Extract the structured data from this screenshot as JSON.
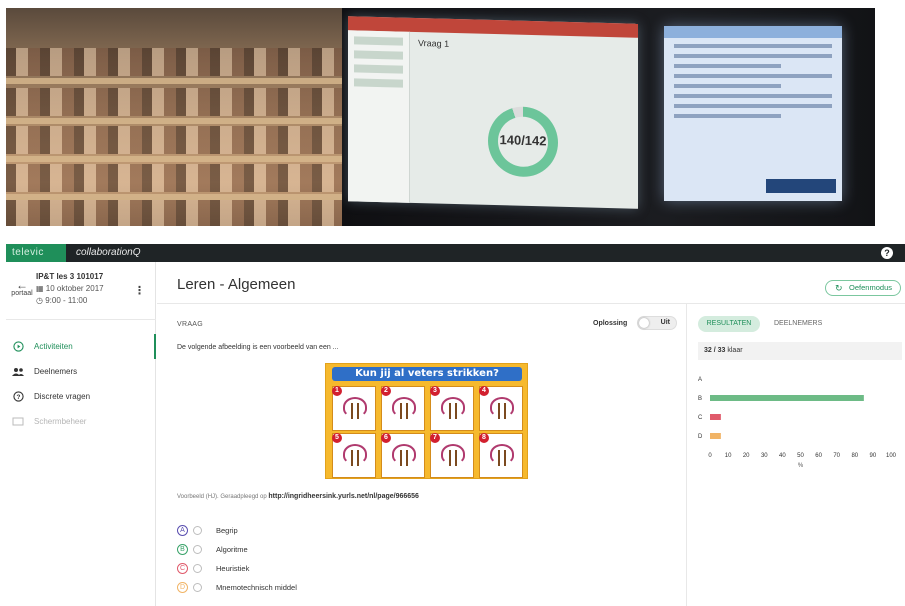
{
  "projection": {
    "vraag_label": "Vraag 1",
    "count": "140/142"
  },
  "app": {
    "brand": "televic",
    "product": "collaborationQ",
    "help_icon": "question-circle-icon"
  },
  "session": {
    "back_label": "portaal",
    "title": "IP&T les 3 101017",
    "date": "10 oktober 2017",
    "time": "9:00 - 11:00"
  },
  "nav": {
    "items": [
      {
        "label": "Activiteiten",
        "icon": "play-circle-icon",
        "state": "active"
      },
      {
        "label": "Deelnemers",
        "icon": "people-icon",
        "state": "normal"
      },
      {
        "label": "Discrete vragen",
        "icon": "question-circle-icon",
        "state": "normal"
      },
      {
        "label": "Schermbeheer",
        "icon": "screen-icon",
        "state": "disabled"
      }
    ]
  },
  "main": {
    "title": "Leren - Algemeen",
    "practice_button": "Oefenmodus"
  },
  "question": {
    "label": "VRAAG",
    "solution_label": "Oplossing",
    "solution_toggle": "Uit",
    "text": "De volgende afbeelding is een voorbeeld van een ...",
    "image_title": "Kun jij al veters strikken?",
    "image_steps": [
      "1",
      "2",
      "3",
      "4",
      "5",
      "6",
      "7",
      "8"
    ],
    "source_prefix": "Voorbeeld (HJ). Geraadpleegd op",
    "source_url": "http://ingridheersink.yurls.net/nl/page/966656",
    "answers": [
      {
        "letter": "A",
        "text": "Begrip",
        "color": "#5a4fb0"
      },
      {
        "letter": "B",
        "text": "Algoritme",
        "color": "#3aa36a"
      },
      {
        "letter": "C",
        "text": "Heuristiek",
        "color": "#e05a6b"
      },
      {
        "letter": "D",
        "text": "Mnemotechnisch middel",
        "color": "#f1b466"
      }
    ]
  },
  "results": {
    "tab_results": "RESULTATEN",
    "tab_participants": "DEELNEMERS",
    "ready_count": "32 / 33",
    "ready_label": "klaar"
  },
  "chart_data": {
    "type": "bar",
    "orientation": "horizontal",
    "categories": [
      "A",
      "B",
      "C",
      "D"
    ],
    "values": [
      0,
      85,
      6,
      6
    ],
    "colors": [
      "#5a4fb0",
      "#6dbb86",
      "#e05a6b",
      "#f1b466"
    ],
    "x_ticks": [
      0,
      10,
      20,
      30,
      40,
      50,
      60,
      70,
      80,
      90,
      100
    ],
    "xlabel": "%",
    "xlim": [
      0,
      100
    ]
  }
}
